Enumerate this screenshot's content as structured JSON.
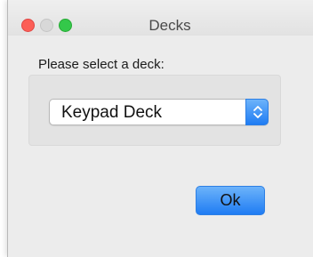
{
  "window": {
    "title": "Decks"
  },
  "dialog": {
    "prompt": "Please select a deck:",
    "deck_select": {
      "selected": "Keypad Deck",
      "icon": "up-down-chevron-icon"
    },
    "ok_label": "Ok"
  },
  "colors": {
    "close": "#fc5f57",
    "minimize": "#d8d8d8",
    "zoom": "#34c84a",
    "accent": "#1f7cf3",
    "window_bg": "#ececec",
    "group_bg": "#e3e3e3"
  }
}
